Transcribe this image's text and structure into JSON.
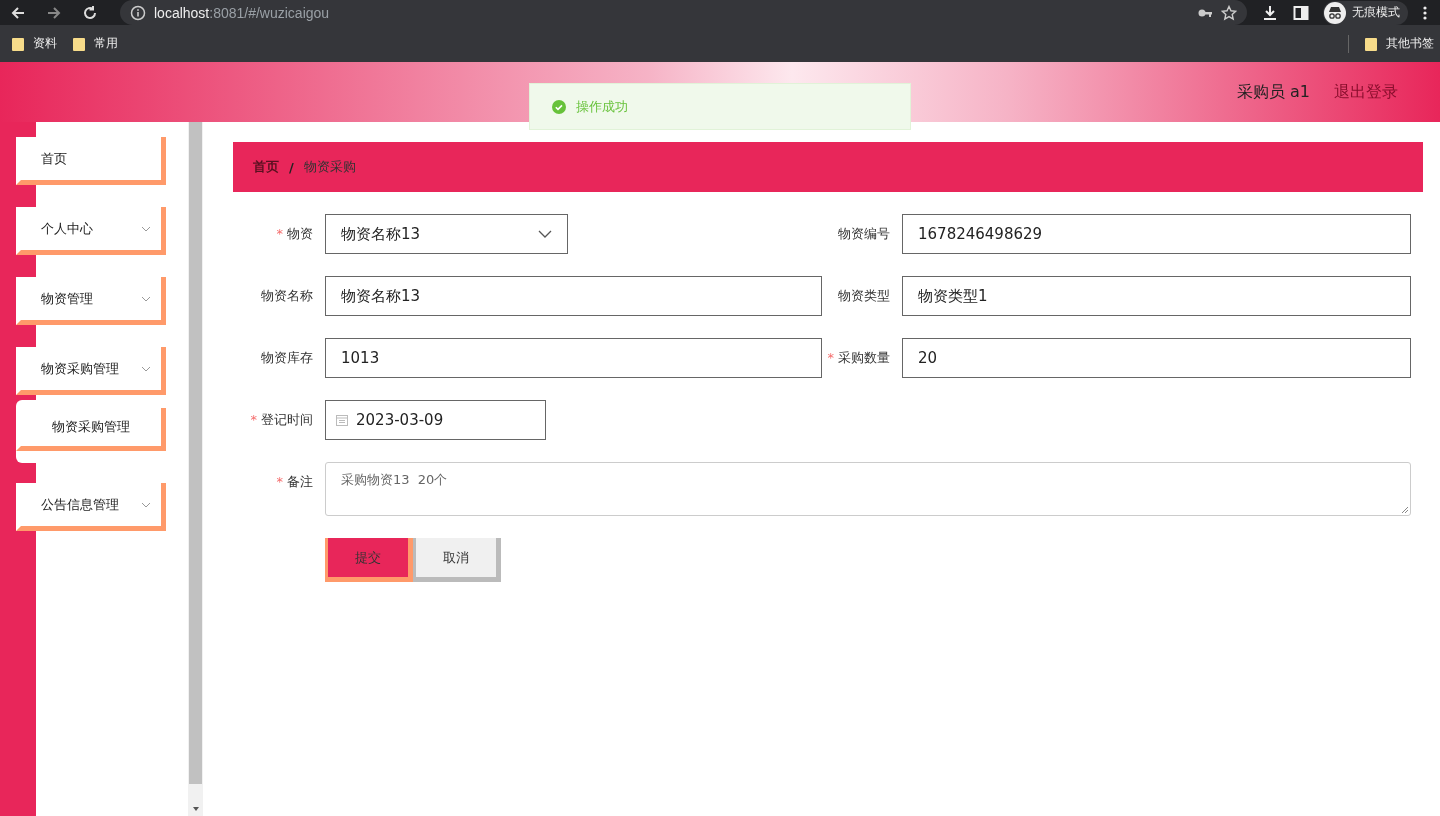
{
  "browser": {
    "url_host": "localhost",
    "url_path": ":8081/#/wuzicaigou",
    "profile": "无痕模式"
  },
  "bookmarks": [
    "资料",
    "常用"
  ],
  "other_bookmarks": "其他书签",
  "header": {
    "user": "采购员 a1",
    "logout": "退出登录"
  },
  "toast": {
    "kind": "success",
    "message": "操作成功"
  },
  "menu": [
    {
      "label": "首页",
      "expandable": false
    },
    {
      "label": "个人中心",
      "expandable": true
    },
    {
      "label": "物资管理",
      "expandable": true
    },
    {
      "label": "物资采购管理",
      "expandable": true,
      "children": [
        {
          "label": "物资采购管理"
        }
      ]
    },
    {
      "label": "公告信息管理",
      "expandable": true
    }
  ],
  "breadcrumb": [
    "首页",
    "物资采购"
  ],
  "breadcrumb_separator": "/",
  "required_mark": "*",
  "form_rows": [
    [
      {
        "label": "物资",
        "required": true,
        "kind": "select",
        "value": "物资名称13"
      },
      {
        "label": "物资编号",
        "required": false,
        "kind": "input",
        "value": "1678246498629"
      }
    ],
    [
      {
        "label": "物资名称",
        "required": false,
        "kind": "input",
        "value": "物资名称13"
      },
      {
        "label": "物资类型",
        "required": false,
        "kind": "input",
        "value": "物资类型1"
      }
    ],
    [
      {
        "label": "物资库存",
        "required": false,
        "kind": "input",
        "value": "1013"
      },
      {
        "label": "采购数量",
        "required": true,
        "kind": "input",
        "value": "20"
      }
    ],
    [
      {
        "label": "登记时间",
        "required": true,
        "kind": "date",
        "value": "2023-03-09"
      }
    ],
    [
      {
        "label": "备注",
        "required": true,
        "kind": "textarea",
        "value": "采购物资13  20个"
      }
    ]
  ],
  "buttons": [
    {
      "label": "提交",
      "kind": "primary"
    },
    {
      "label": "取消",
      "kind": "default"
    }
  ]
}
